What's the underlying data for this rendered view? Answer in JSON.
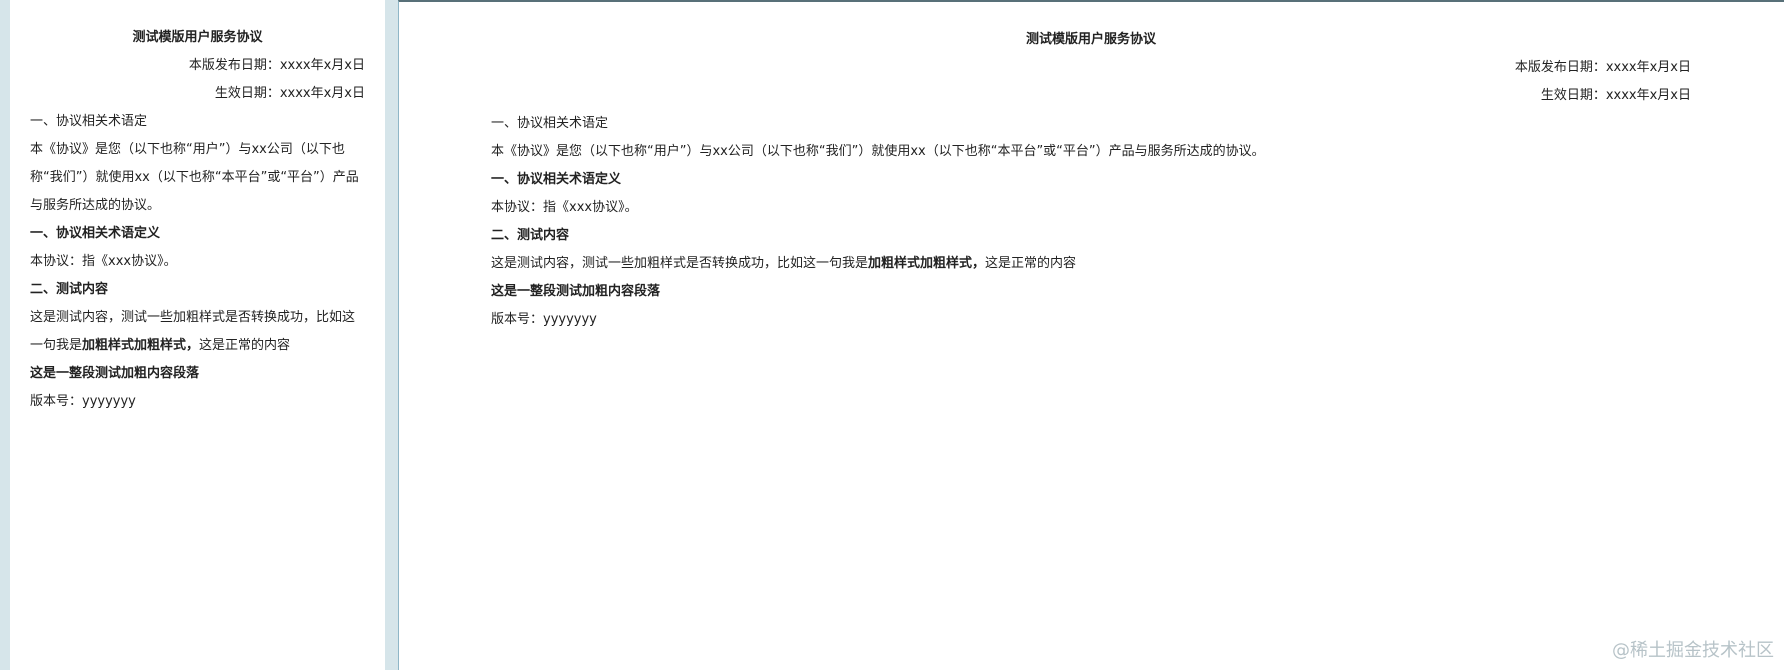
{
  "doc": {
    "title": "测试模版用户服务协议",
    "publish_date": "本版发布日期：xxxx年x月x日",
    "effective_date": "生效日期：xxxx年x月x日",
    "section1_heading": "一、协议相关术语定",
    "intro_text": "本《协议》是您（以下也称“用户”）与xx公司（以下也称“我们”）就使用xx（以下也称“本平台”或“平台”）产品与服务所达成的协议。",
    "section1_bold_heading": "一、协议相关术语定义",
    "definition_text": "本协议：指《xxx协议》。",
    "section2_heading": "二、测试内容",
    "test_text_prefix": "这是测试内容，测试一些加粗样式是否转换成功，比如这一句我是",
    "test_text_bold": "加粗样式加粗样式，",
    "test_text_suffix": "这是正常的内容",
    "bold_paragraph": "这是一整段测试加粗内容段落",
    "version_label": "版本号：",
    "version_value": "yyyyyyy"
  },
  "watermark": "@稀土掘金技术社区",
  "colors": {
    "background": "#d6e5ea",
    "panel": "#ffffff",
    "text": "#222222",
    "watermark": "#b7c3c8"
  }
}
